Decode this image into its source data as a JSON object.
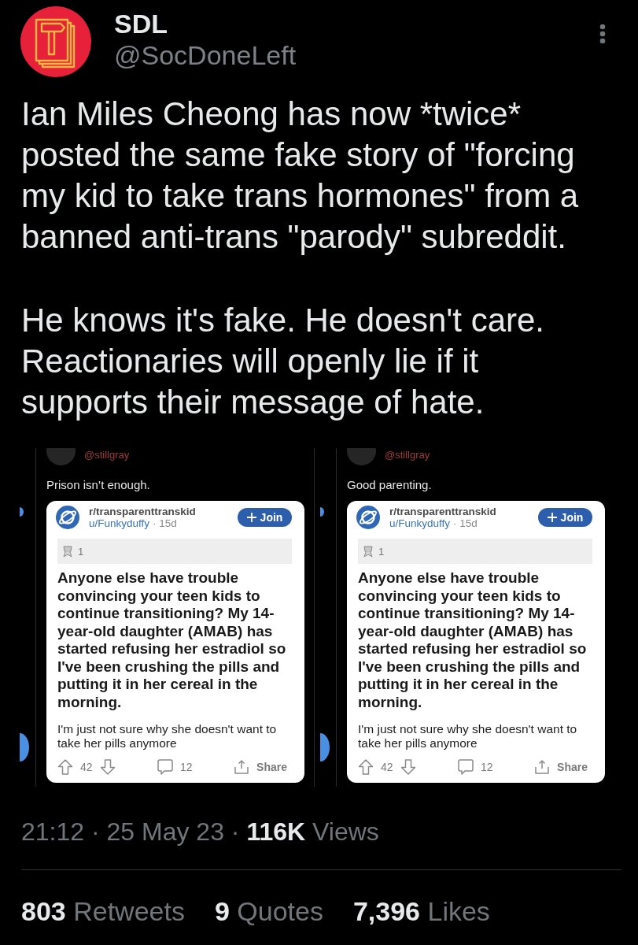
{
  "author": {
    "name": "SDL",
    "handle": "@SocDoneLeft"
  },
  "tweet": {
    "paragraphs": [
      "Ian Miles Cheong has now *twice*\nposted the same fake story of \"forcing\nmy kid to take trans hormones\" from a\nbanned anti-trans \"parody\" subreddit.",
      "He knows it's fake. He doesn't care.\nReactionaries will openly lie if it\nsupports their message of hate."
    ]
  },
  "screenshots": [
    {
      "handle": "@stillgray",
      "reply": "Prison isn’t enough.",
      "post": {
        "subreddit": "r/transparenttranskid",
        "user": "u/Funkyduffy",
        "age": "· 15d",
        "join": "Join",
        "award_count": "1",
        "title": "Anyone else have trouble convincing your teen kids to continue transitioning? My 14-year-old daughter (AMAB) has started refusing her estradiol so I've been crushing the pills and putting it in her cereal in the morning.",
        "body": "I'm just not sure why she doesn't want to take her pills anymore",
        "upvotes": "42",
        "comments": "12",
        "share": "Share"
      }
    },
    {
      "handle": "@stillgray",
      "reply": "Good parenting.",
      "post": {
        "subreddit": "r/transparenttranskid",
        "user": "u/Funkyduffy",
        "age": "· 15d",
        "join": "Join",
        "award_count": "1",
        "title": "Anyone else have trouble convincing your teen kids to continue transitioning? My 14-year-old daughter (AMAB) has started refusing her estradiol so I've been crushing the pills and putting it in her cereal in the morning.",
        "body": "I'm just not sure why she doesn't want to take her pills anymore",
        "upvotes": "42",
        "comments": "12",
        "share": "Share"
      }
    }
  ],
  "meta": "21:12 · 25 May 23 · **116K** Views",
  "stats": [
    {
      "count": "803",
      "label": "Retweets"
    },
    {
      "count": "9",
      "label": "Quotes"
    },
    {
      "count": "7,396",
      "label": "Likes"
    }
  ]
}
